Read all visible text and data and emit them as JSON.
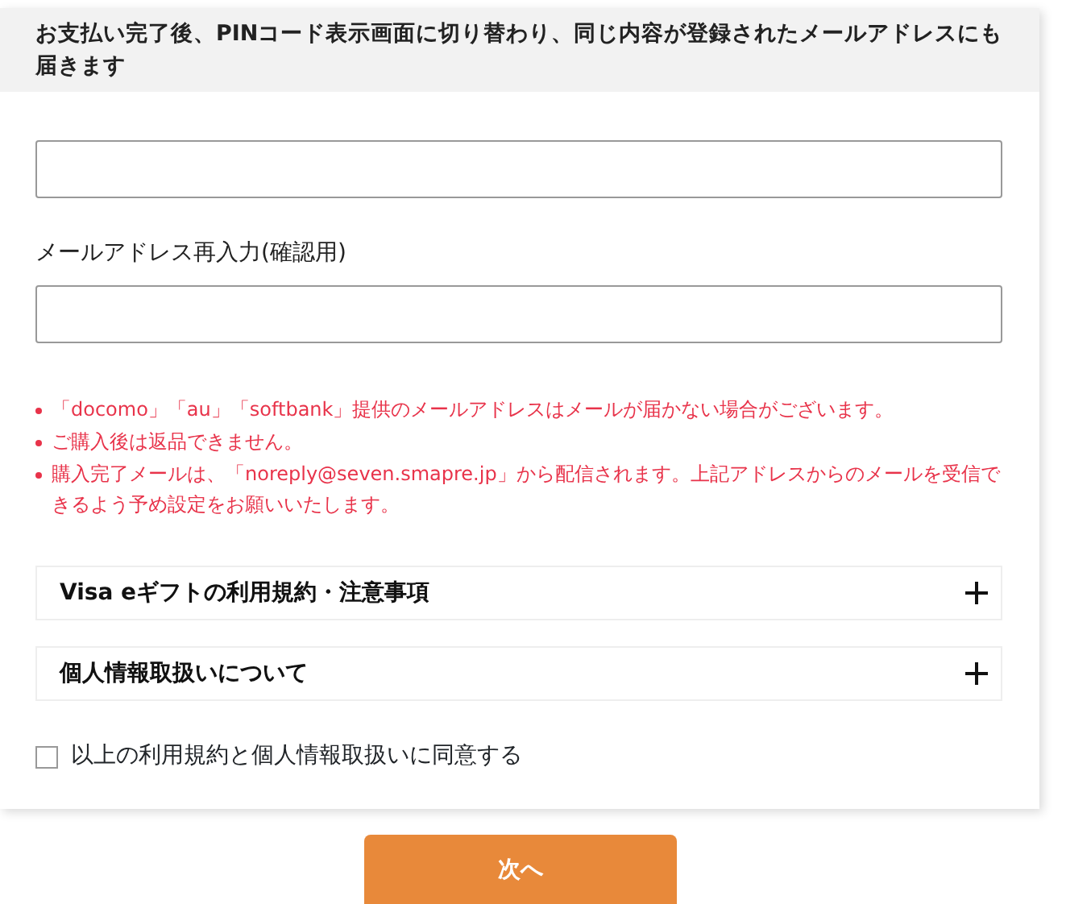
{
  "notice": "お支払い完了後、PINコード表示画面に切り替わり、同じ内容が登録されたメールアドレスにも届きます",
  "confirm_label": "メールアドレス再入力(確認用)",
  "notes": [
    "「docomo」「au」「softbank」提供のメールアドレスはメールが届かない場合がございます。",
    "ご購入後は返品できません。",
    "購入完了メールは、「noreply@seven.smapre.jp」から配信されます。上記アドレスからのメールを受信できるよう予め設定をお願いいたします。"
  ],
  "sections": [
    {
      "title": "Visa eギフトの利用規約・注意事項",
      "expanded": false
    },
    {
      "title": "個人情報取扱いについて",
      "expanded": false
    }
  ],
  "agreement": {
    "label": "以上の利用規約と個人情報取扱いに同意する",
    "checked": false
  },
  "next_button": "次へ"
}
